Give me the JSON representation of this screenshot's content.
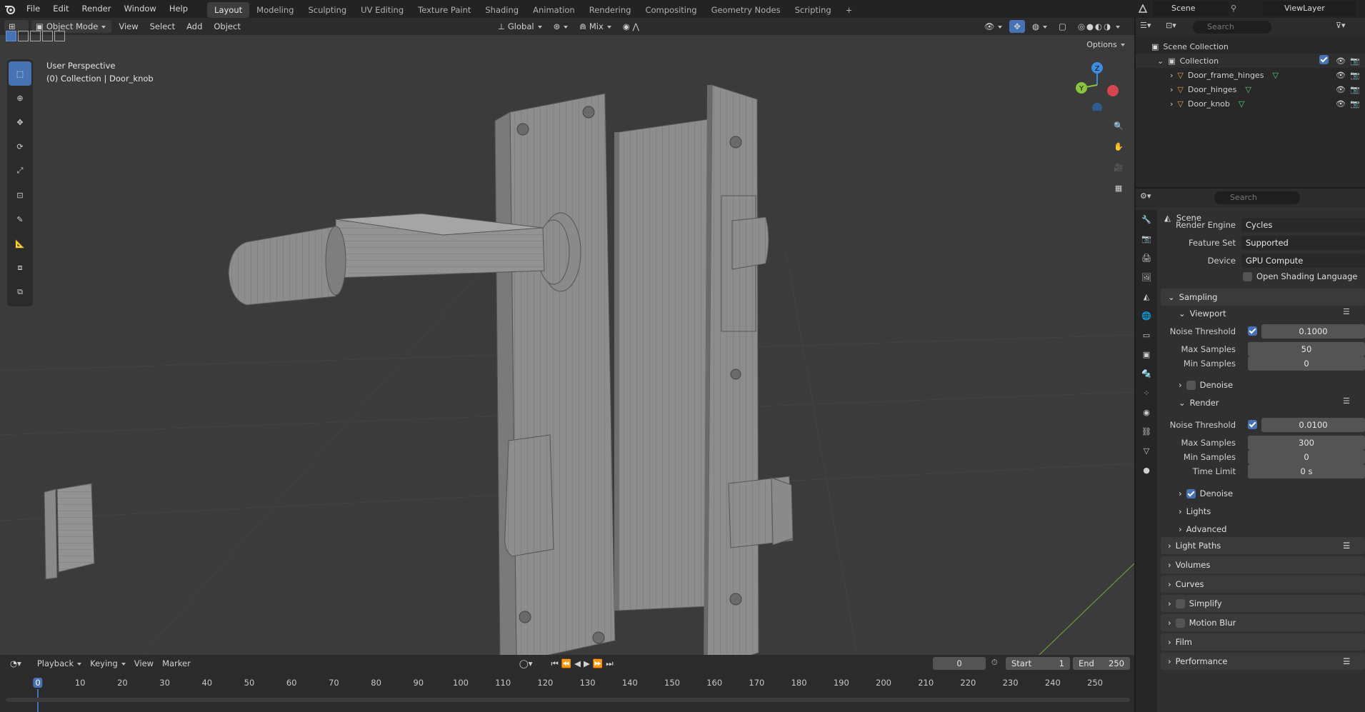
{
  "menubar": {
    "items": [
      "File",
      "Edit",
      "Render",
      "Window",
      "Help"
    ]
  },
  "workspaces": {
    "tabs": [
      "Layout",
      "Modeling",
      "Sculpting",
      "UV Editing",
      "Texture Paint",
      "Shading",
      "Animation",
      "Rendering",
      "Compositing",
      "Geometry Nodes",
      "Scripting"
    ],
    "active": "Layout",
    "add": "+"
  },
  "scene": {
    "name": "Scene",
    "view_layer": "ViewLayer"
  },
  "viewport": {
    "mode": "Object Mode",
    "menus": [
      "View",
      "Select",
      "Add",
      "Object"
    ],
    "orientation": "Global",
    "snap": "Mix",
    "options": "Options",
    "overlay_line1": "User Perspective",
    "overlay_line2": "(0) Collection | Door_knob",
    "gizmo": {
      "z": "Z",
      "y": "Y"
    }
  },
  "outliner": {
    "search_placeholder": "Search",
    "root": "Scene Collection",
    "collection": "Collection",
    "objects": [
      "Door_frame_hinges",
      "Door_hinges",
      "Door_knob"
    ]
  },
  "properties": {
    "search_placeholder": "Search",
    "context": "Scene",
    "render_engine_label": "Render Engine",
    "render_engine": "Cycles",
    "feature_set_label": "Feature Set",
    "feature_set": "Supported",
    "device_label": "Device",
    "device": "GPU Compute",
    "osl_label": "Open Shading Language",
    "sampling": "Sampling",
    "viewport": {
      "title": "Viewport",
      "noise_label": "Noise Threshold",
      "noise": "0.1000",
      "max_label": "Max Samples",
      "max": "50",
      "min_label": "Min Samples",
      "min": "0",
      "denoise": "Denoise"
    },
    "render": {
      "title": "Render",
      "noise_label": "Noise Threshold",
      "noise": "0.0100",
      "max_label": "Max Samples",
      "max": "300",
      "min_label": "Min Samples",
      "min": "0",
      "time_label": "Time Limit",
      "time": "0 s",
      "denoise": "Denoise",
      "lights": "Lights",
      "advanced": "Advanced"
    },
    "panels": [
      "Light Paths",
      "Volumes",
      "Curves",
      "Simplify",
      "Motion Blur",
      "Film",
      "Performance"
    ]
  },
  "timeline": {
    "menus": [
      "Playback",
      "Keying",
      "View",
      "Marker"
    ],
    "current_frame": "0",
    "start_label": "Start",
    "start": "1",
    "end_label": "End",
    "end": "250",
    "ticks": [
      "0",
      "10",
      "20",
      "30",
      "40",
      "50",
      "60",
      "70",
      "80",
      "90",
      "100",
      "110",
      "120",
      "130",
      "140",
      "150",
      "160",
      "170",
      "180",
      "190",
      "200",
      "210",
      "220",
      "230",
      "240",
      "250"
    ],
    "playhead": "0"
  },
  "colors": {
    "accent": "#4772b3",
    "axis_x": "#d4474f",
    "axis_y": "#8ac43f",
    "axis_z": "#3b8ee0",
    "playhead": "#4772b3"
  }
}
